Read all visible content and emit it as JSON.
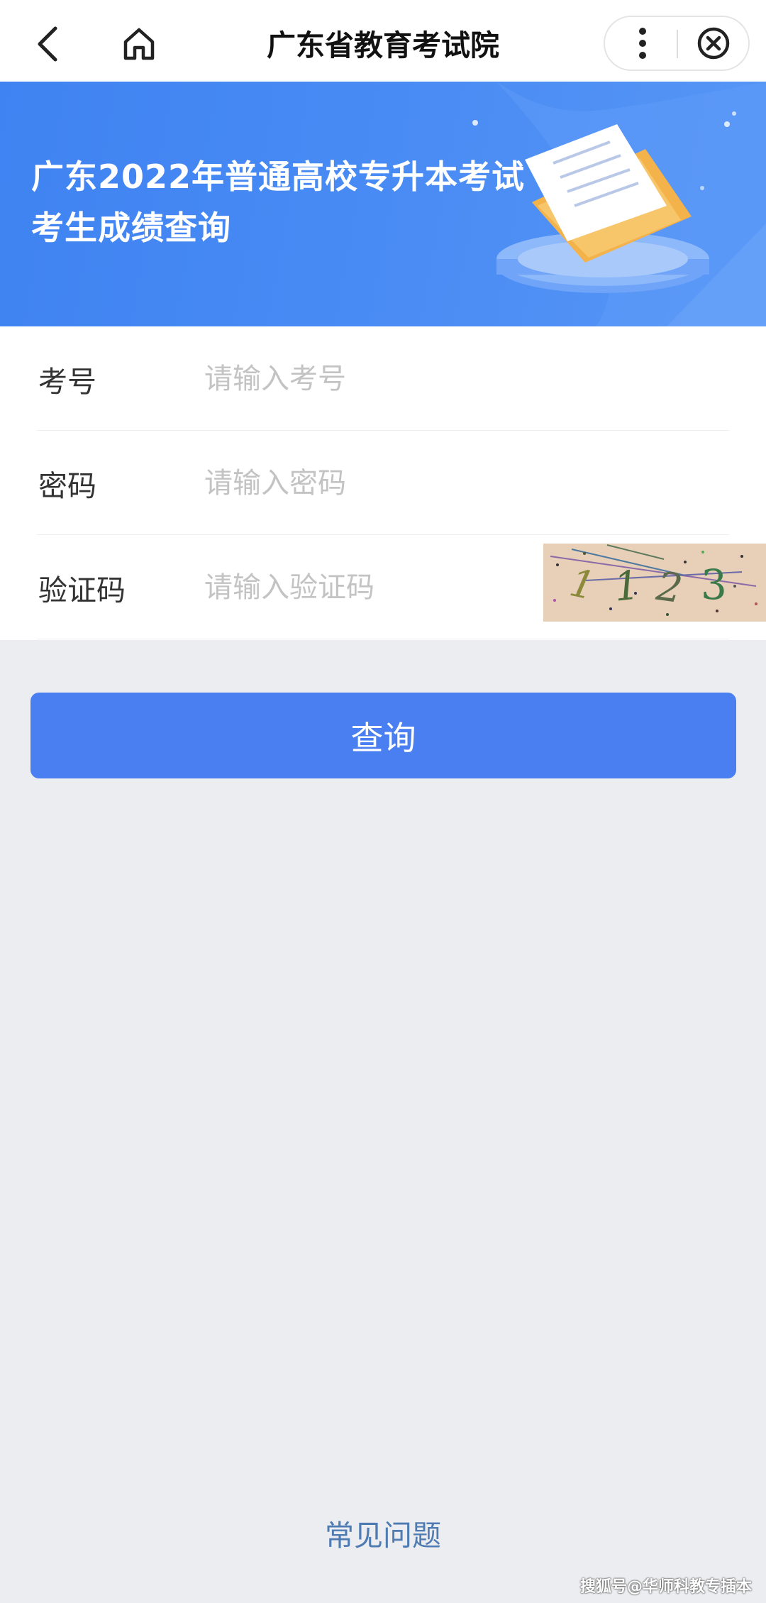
{
  "navbar": {
    "title": "广东省教育考试院",
    "back_icon": "chevron-left-icon",
    "home_icon": "home-icon",
    "more_icon": "more-vertical-icon",
    "close_icon": "close-circle-icon"
  },
  "banner": {
    "title_line1": "广东2022年普通高校专升本考试",
    "title_line2": "考生成绩查询",
    "background_color": "#4a8cf4"
  },
  "form": {
    "fields": [
      {
        "label": "考号",
        "placeholder": "请输入考号",
        "value": ""
      },
      {
        "label": "密码",
        "placeholder": "请输入密码",
        "value": ""
      },
      {
        "label": "验证码",
        "placeholder": "请输入验证码",
        "value": ""
      }
    ],
    "captcha": {
      "chars": [
        "1",
        "1",
        "2",
        "3"
      ],
      "char_colors": [
        "#8a8a3a",
        "#4a6a3a",
        "#5a6a4a",
        "#3a7a4a"
      ],
      "background_color": "#e8cfb8"
    }
  },
  "actions": {
    "query_label": "查询",
    "button_color": "#4a7ff2"
  },
  "footer": {
    "faq_label": "常见问题",
    "watermark": "搜狐号@华师科教专插本"
  }
}
